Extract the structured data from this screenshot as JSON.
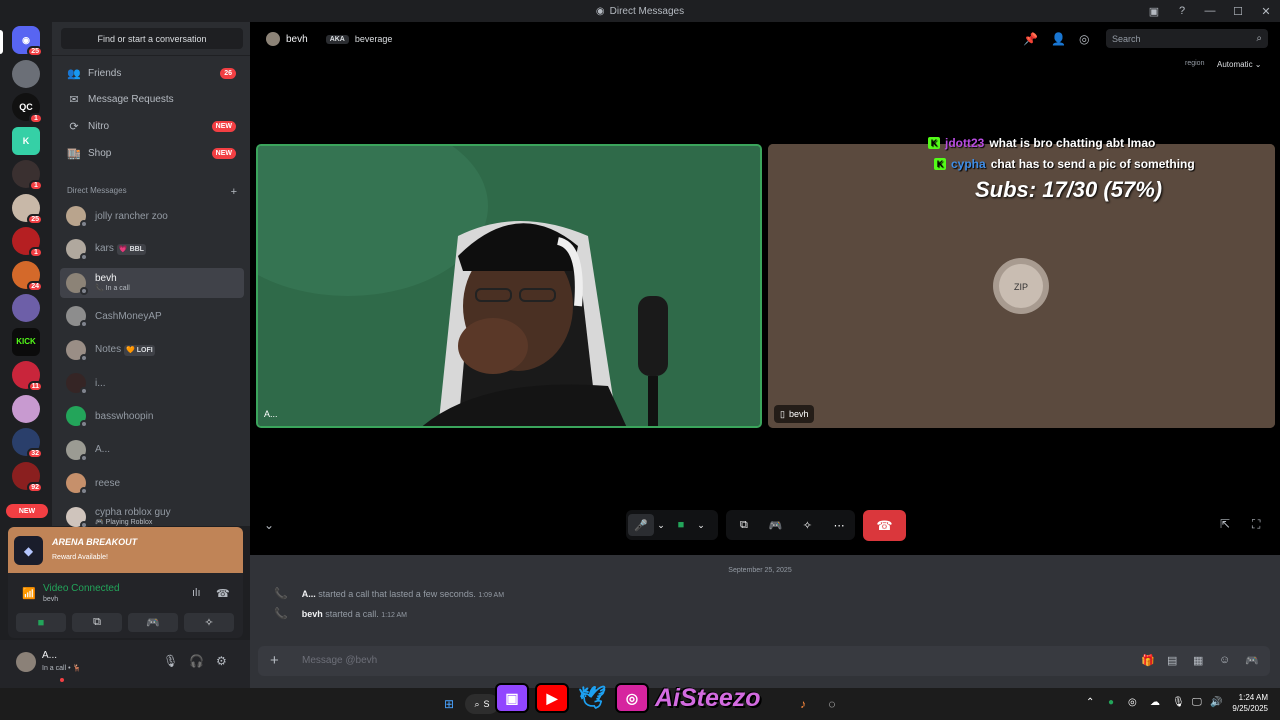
{
  "window": {
    "title": "Direct Messages"
  },
  "rail": {
    "servers": [
      {
        "badge": "25",
        "color": "#5865f2",
        "glyph": "◉"
      },
      {
        "badge": "",
        "color": "#6b6f77",
        "glyph": ""
      },
      {
        "badge": "1",
        "color": "#111111",
        "glyph": "QC"
      },
      {
        "badge": "",
        "color": "#35d0a6",
        "glyph": "K"
      },
      {
        "badge": "1",
        "color": "#3a3030",
        "glyph": ""
      },
      {
        "badge": "25",
        "color": "#c8b8a8",
        "glyph": ""
      },
      {
        "badge": "1",
        "color": "#b51f22",
        "glyph": ""
      },
      {
        "badge": "24",
        "color": "#d4692a",
        "glyph": ""
      },
      {
        "badge": "",
        "color": "#6d5fa8",
        "glyph": ""
      },
      {
        "badge": "",
        "color": "#0b0b0b",
        "glyph": "KICK"
      },
      {
        "badge": "11",
        "color": "#c9253b",
        "glyph": ""
      },
      {
        "badge": "",
        "color": "#c89ad0",
        "glyph": ""
      },
      {
        "badge": "32",
        "color": "#2a3f6b",
        "glyph": ""
      },
      {
        "badge": "92",
        "color": "#8a1f1f",
        "glyph": ""
      }
    ],
    "new_label": "NEW"
  },
  "sidebar": {
    "find": "Find or start a conversation",
    "nav": [
      {
        "label": "Friends",
        "icon": "friends-icon",
        "glyph": "👥",
        "tag": "26"
      },
      {
        "label": "Message Requests",
        "icon": "mail-icon",
        "glyph": "✉",
        "tag": ""
      },
      {
        "label": "Nitro",
        "icon": "nitro-icon",
        "glyph": "⟳",
        "tag": "NEW"
      },
      {
        "label": "Shop",
        "icon": "shop-icon",
        "glyph": "🏬",
        "tag": "NEW"
      }
    ],
    "dm_header": "Direct Messages",
    "dms": [
      {
        "name": "jolly rancher zoo",
        "sub": "",
        "chip": "",
        "color": "#b9a48d"
      },
      {
        "name": "kars",
        "sub": "",
        "chip": "💗 BBL",
        "color": "#b0a89e"
      },
      {
        "name": "bevh",
        "sub": "📞 In a call",
        "chip": "",
        "color": "#8c8377"
      },
      {
        "name": "CashMoneyAP",
        "sub": "",
        "chip": "",
        "color": "#8d8d8d"
      },
      {
        "name": "Notes",
        "sub": "",
        "chip": "🧡 LOFI",
        "color": "#9a8e86"
      },
      {
        "name": "i...",
        "sub": "",
        "chip": "",
        "color": "#352525"
      },
      {
        "name": "basswhoopin",
        "sub": "",
        "chip": "",
        "color": "#23a55a"
      },
      {
        "name": "A...",
        "sub": "",
        "chip": "",
        "color": "#9b9b93"
      },
      {
        "name": "reese",
        "sub": "",
        "chip": "",
        "color": "#c6906b"
      },
      {
        "name": "cypha roblox guy",
        "sub": "🎮 Playing Roblox",
        "chip": "",
        "color": "#cfc4bc"
      }
    ]
  },
  "promo": {
    "title": "ARENA BREAKOUT",
    "subtitle": "Reward Available!"
  },
  "voice": {
    "status": "Video Connected",
    "channel": "bevh"
  },
  "user": {
    "name": "A...",
    "status": "In a call • 🦌"
  },
  "header": {
    "username": "bevh",
    "aka": "AKA",
    "alias": "beverage",
    "search_placeholder": "Search",
    "region_label": "region",
    "region_value": "Automatic ⌄"
  },
  "tiles": {
    "left_name": "A...",
    "right_name": "bevh"
  },
  "overlay": {
    "chat": [
      {
        "user": "jdott23",
        "text": "what is bro chatting abt lmao",
        "color": "#b84ce0"
      },
      {
        "user": "cypha",
        "text": "chat has to send a pic of something",
        "color": "#3f8ee8"
      }
    ],
    "subs": "Subs: 17/30 (57%)"
  },
  "chat": {
    "date": "September 25, 2025",
    "messages": [
      {
        "author": "A...",
        "text": "started a call that lasted a few seconds.",
        "time": "1:09 AM"
      },
      {
        "author": "bevh",
        "text": "started a call.",
        "time": "1:12 AM"
      }
    ],
    "placeholder": "Message @bevh"
  },
  "taskbar": {
    "search": "S",
    "brand": "AiSteezo",
    "time": "1:24 AM",
    "date": "9/25/2025"
  }
}
